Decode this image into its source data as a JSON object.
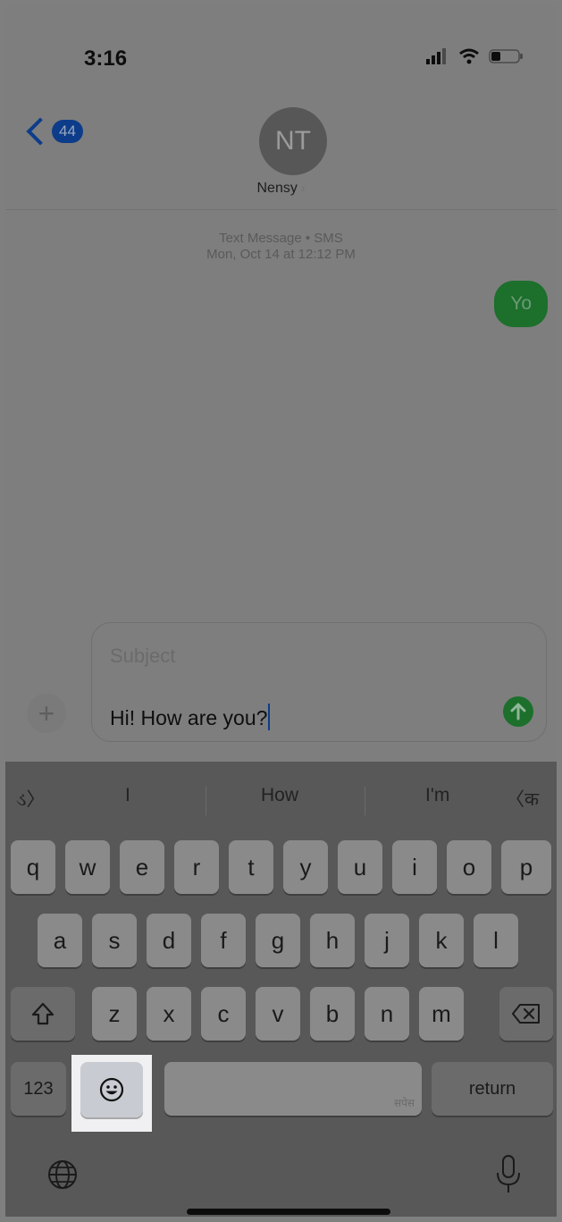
{
  "status": {
    "time": "3:16"
  },
  "header": {
    "back_count": "44",
    "avatar_initials": "NT",
    "contact_name": "Nensy"
  },
  "thread": {
    "meta_line1": "Text Message • SMS",
    "meta_line2": "Mon, Oct 14 at 12:12 PM",
    "messages": [
      {
        "text": "Yo",
        "from": "me"
      }
    ]
  },
  "composer": {
    "subject_placeholder": "Subject",
    "typed_text": "Hi! How are you?"
  },
  "keyboard": {
    "suggestions": [
      "ડ〉",
      "I",
      "How",
      "I'm",
      "〈क"
    ],
    "rows": [
      [
        "q",
        "w",
        "e",
        "r",
        "t",
        "y",
        "u",
        "i",
        "o",
        "p"
      ],
      [
        "a",
        "s",
        "d",
        "f",
        "g",
        "h",
        "j",
        "k",
        "l"
      ],
      [
        "z",
        "x",
        "c",
        "v",
        "b",
        "n",
        "m"
      ]
    ],
    "numbers_label": "123",
    "space_label": "सपेस",
    "return_label": "return"
  },
  "colors": {
    "accent": "#0d3c8a",
    "sms_green": "#1d6f2c"
  }
}
